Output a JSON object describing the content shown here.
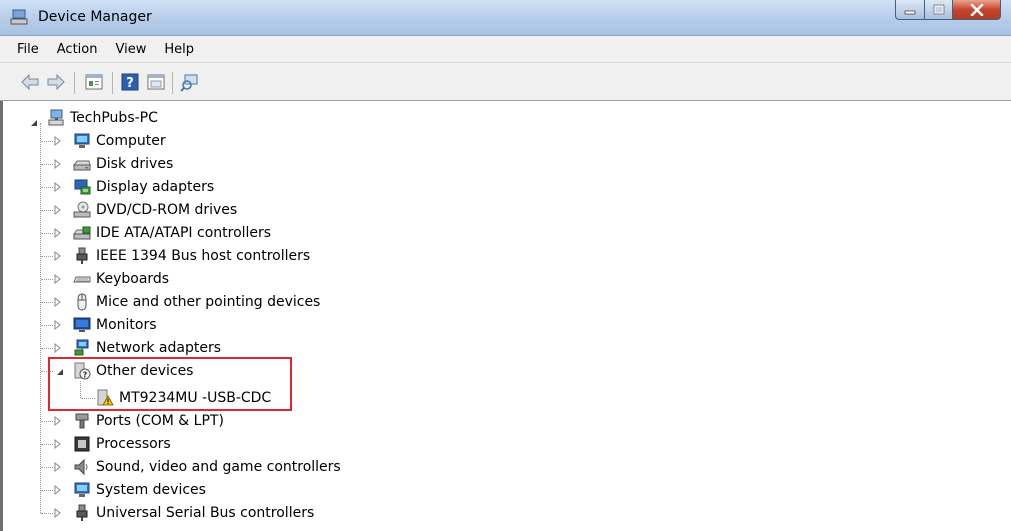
{
  "window": {
    "title": "Device Manager",
    "controls": {
      "minimize": "minimize",
      "maximize": "maximize",
      "close": "close"
    }
  },
  "menu": [
    "File",
    "Action",
    "View",
    "Help"
  ],
  "toolbar": [
    "back-icon",
    "forward-icon",
    "properties-icon",
    "help-icon",
    "show-hidden-icon",
    "scan-hardware-icon"
  ],
  "tree": {
    "root": {
      "label": "TechPubs-PC",
      "expanded": true
    },
    "categories": [
      {
        "label": "Computer",
        "icon": "computer-icon"
      },
      {
        "label": "Disk drives",
        "icon": "disk-drive-icon"
      },
      {
        "label": "Display adapters",
        "icon": "display-adapter-icon"
      },
      {
        "label": "DVD/CD-ROM drives",
        "icon": "dvd-drive-icon"
      },
      {
        "label": "IDE ATA/ATAPI controllers",
        "icon": "ide-controller-icon"
      },
      {
        "label": "IEEE 1394 Bus host controllers",
        "icon": "ieee1394-icon"
      },
      {
        "label": "Keyboards",
        "icon": "keyboard-icon"
      },
      {
        "label": "Mice and other pointing devices",
        "icon": "mouse-icon"
      },
      {
        "label": "Monitors",
        "icon": "monitor-icon"
      },
      {
        "label": "Network adapters",
        "icon": "network-adapter-icon"
      },
      {
        "label": "Other devices",
        "icon": "unknown-device-icon",
        "expanded": true,
        "children": [
          {
            "label": "MT9234MU -USB-CDC",
            "icon": "warning-device-icon"
          }
        ]
      },
      {
        "label": "Ports (COM & LPT)",
        "icon": "port-icon"
      },
      {
        "label": "Processors",
        "icon": "processor-icon"
      },
      {
        "label": "Sound, video and game controllers",
        "icon": "sound-icon"
      },
      {
        "label": "System devices",
        "icon": "system-device-icon"
      },
      {
        "label": "Universal Serial Bus controllers",
        "icon": "usb-icon"
      }
    ]
  },
  "colors": {
    "highlight_border": "#e0262e",
    "title_bar": "#b6cde9",
    "close_button": "#c8452c"
  }
}
